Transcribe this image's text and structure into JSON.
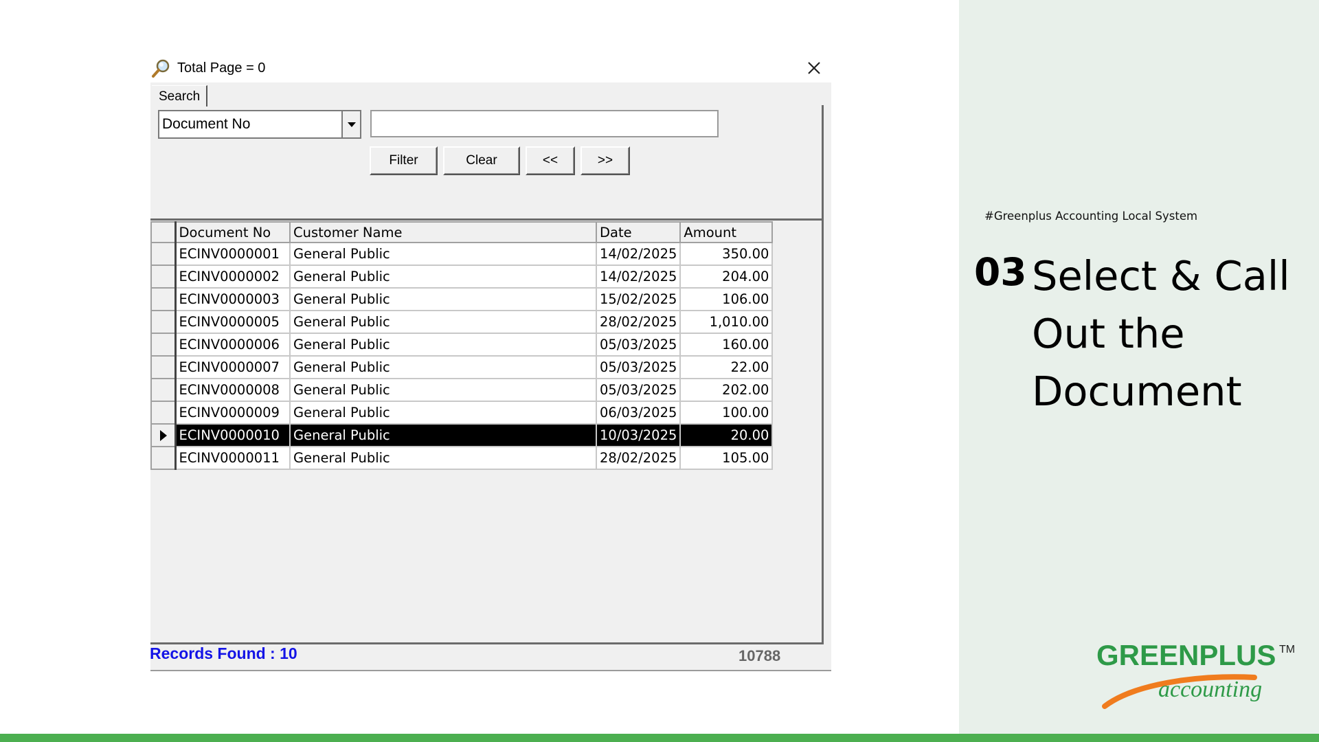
{
  "dialog": {
    "title": "Total Page = 0",
    "tab_label": "Search",
    "search_field": {
      "selected": "Document No"
    },
    "search_input": {
      "value": "",
      "placeholder": ""
    },
    "buttons": {
      "filter": "Filter",
      "clear": "Clear",
      "prev": "<<",
      "next": ">>"
    },
    "table": {
      "headers": [
        "Document No",
        "Customer Name",
        "Date",
        "Amount"
      ],
      "rows": [
        [
          "ECINV0000001",
          "General Public",
          "14/02/2025",
          "350.00"
        ],
        [
          "ECINV0000002",
          "General Public",
          "14/02/2025",
          "204.00"
        ],
        [
          "ECINV0000003",
          "General Public",
          "15/02/2025",
          "106.00"
        ],
        [
          "ECINV0000005",
          "General Public",
          "28/02/2025",
          "1,010.00"
        ],
        [
          "ECINV0000006",
          "General Public",
          "05/03/2025",
          "160.00"
        ],
        [
          "ECINV0000007",
          "General Public",
          "05/03/2025",
          "22.00"
        ],
        [
          "ECINV0000008",
          "General Public",
          "05/03/2025",
          "202.00"
        ],
        [
          "ECINV0000009",
          "General Public",
          "06/03/2025",
          "100.00"
        ],
        [
          "ECINV0000010",
          "General Public",
          "10/03/2025",
          "20.00"
        ],
        [
          "ECINV0000011",
          "General Public",
          "28/02/2025",
          "105.00"
        ]
      ],
      "selected_row": 8
    },
    "records_found": "Records Found : 10",
    "code": "10788"
  },
  "slide": {
    "tagline": "#Greenplus Accounting Local System",
    "step_number": "03",
    "step_title": "Select & Call Out the Document",
    "logo": {
      "brand": "GREENPLUS",
      "sub": "accounting",
      "tm": "TM"
    }
  },
  "colors": {
    "accent_green": "#4caf50",
    "side_bg": "#e8f0ea",
    "records_blue": "#1414e6",
    "logo_green": "#2e9a48",
    "logo_orange": "#f07c1e"
  },
  "icons": {
    "title_icon": "magnifier-icon",
    "close": "close-icon",
    "dropdown": "chevron-down-icon",
    "row_pointer": "row-pointer-icon"
  }
}
